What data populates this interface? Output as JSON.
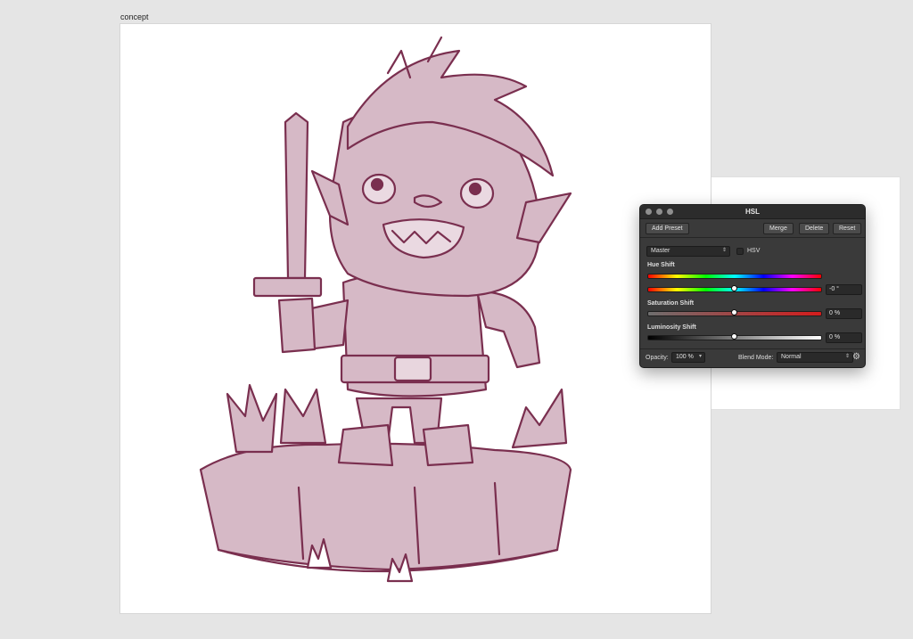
{
  "document": {
    "label": "concept"
  },
  "hsl_panel": {
    "title": "HSL",
    "buttons": {
      "add_preset": "Add Preset",
      "merge": "Merge",
      "delete": "Delete",
      "reset": "Reset"
    },
    "channel": {
      "selected": "Master"
    },
    "hsv": {
      "label": "HSV",
      "checked": false
    },
    "hue": {
      "label": "Hue Shift",
      "value": "-0 °",
      "fraction": 0.5
    },
    "saturation": {
      "label": "Saturation Shift",
      "value": "0 %",
      "fraction": 0.5
    },
    "luminosity": {
      "label": "Luminosity Shift",
      "value": "0 %",
      "fraction": 0.5
    },
    "opacity": {
      "label": "Opacity:",
      "value": "100 %"
    },
    "blend_mode": {
      "label": "Blend Mode:",
      "value": "Normal"
    }
  },
  "colors": {
    "sketch_fill": "#d6b9c6",
    "sketch_line": "#7a2f4f",
    "panel_bg": "#3a3a3a"
  }
}
